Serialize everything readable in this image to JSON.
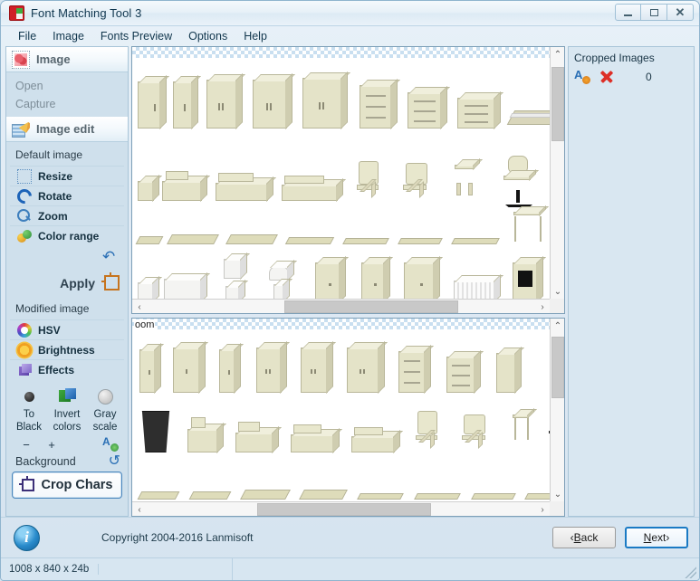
{
  "window": {
    "title": "Font Matching Tool 3",
    "app_icon": "app-logo-icon",
    "minimize": "minimize-icon",
    "maximize": "maximize-icon",
    "close": "close-icon"
  },
  "menubar": {
    "items": [
      {
        "label": "File"
      },
      {
        "label": "Image"
      },
      {
        "label": "Fonts Preview"
      },
      {
        "label": "Options"
      },
      {
        "label": "Help"
      }
    ]
  },
  "sidebar": {
    "image_section": {
      "header": "Image",
      "icon": "image-icon",
      "links": [
        {
          "label": "Open",
          "enabled": false
        },
        {
          "label": "Capture",
          "enabled": false
        }
      ]
    },
    "image_edit_section": {
      "header": "Image edit",
      "icon": "pencil-edit-icon",
      "default_image_label": "Default image",
      "tools": [
        {
          "label": "Resize",
          "icon": "resize-icon"
        },
        {
          "label": "Rotate",
          "icon": "rotate-icon"
        },
        {
          "label": "Zoom",
          "icon": "zoom-icon"
        },
        {
          "label": "Color range",
          "icon": "color-range-icon"
        }
      ],
      "apply_label": "Apply",
      "undo_icon": "undo-icon",
      "crop_icon": "crop-icon",
      "modified_image_label": "Modified image",
      "modified_tools": [
        {
          "label": "HSV",
          "icon": "hsv-icon"
        },
        {
          "label": "Brightness",
          "icon": "brightness-icon"
        },
        {
          "label": "Effects",
          "icon": "effects-icon"
        }
      ],
      "swatches": [
        {
          "label_line1": "To",
          "label_line2": "Black",
          "icon": "to-black-icon"
        },
        {
          "label_line1": "Invert",
          "label_line2": "colors",
          "icon": "invert-colors-icon"
        },
        {
          "label_line1": "Gray",
          "label_line2": "scale",
          "icon": "gray-scale-icon"
        }
      ],
      "minus_label": "−",
      "plus_label": "+",
      "add_icon": "add-font-icon",
      "background_label": "Background",
      "background_undo_icon": "undo-icon",
      "crop_chars_button": "Crop Chars"
    }
  },
  "viewers": {
    "top": {
      "name": "default-image-viewer",
      "vscroll": {
        "thumb_top_pct": 6,
        "thumb_height_pct": 30
      },
      "hscroll": {
        "thumb_left_pct": 37,
        "thumb_width_pct": 42
      },
      "arrows": {
        "up": "⌃",
        "down": "⌄",
        "left": "‹",
        "right": "›"
      }
    },
    "bottom": {
      "name": "modified-image-viewer",
      "cut_label": "oom",
      "vscroll": {
        "thumb_top_pct": 4,
        "thumb_height_pct": 34
      },
      "hscroll": {
        "thumb_left_pct": 30,
        "thumb_width_pct": 42
      },
      "arrows": {
        "up": "⌃",
        "down": "⌄",
        "left": "‹",
        "right": "›"
      }
    }
  },
  "right_panel": {
    "title": "Cropped Images",
    "add_icon": "add-cropped-image-icon",
    "delete_icon": "delete-cropped-image-icon",
    "count": "0"
  },
  "footer": {
    "info_icon": "info-icon",
    "info_glyph": "i",
    "copyright": "Copyright 2004-2016 Lanmisoft",
    "back_button": {
      "prefix": "‹ ",
      "accel": "B",
      "rest": "ack"
    },
    "next_button": {
      "accel": "N",
      "rest": "ext",
      "suffix": " ›"
    },
    "status_dimensions": "1008 x 840 x 24b"
  },
  "colors": {
    "accent_blue": "#1a7ac4",
    "panel_blue": "#cfe0ec",
    "window_bg": "#d6e5f0",
    "furniture_cream": "#e4e3c8",
    "delete_red": "#dd2f27"
  }
}
